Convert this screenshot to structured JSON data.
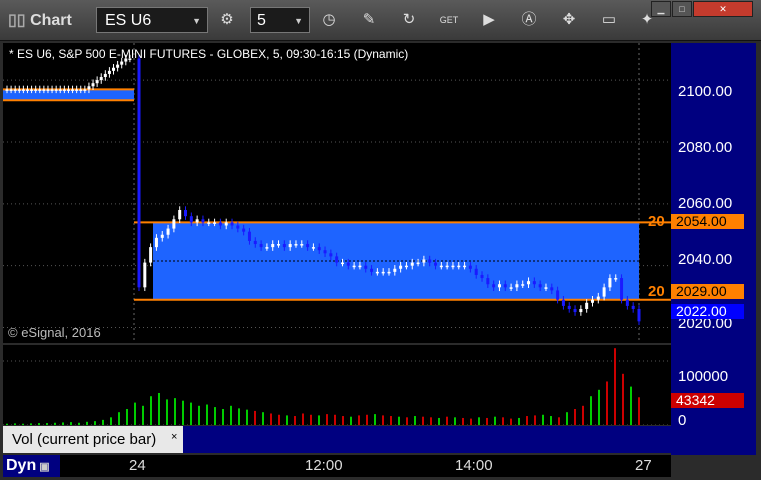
{
  "window": {
    "app_title": "Chart",
    "minimize": "▁",
    "maximize": "□",
    "close": "✕"
  },
  "toolbar": {
    "symbol": "ES U6",
    "interval": "5",
    "icons": [
      "settings-icon",
      "clock-icon",
      "pencil-icon",
      "refresh-icon",
      "get-icon",
      "play-icon",
      "a-icon",
      "tools-icon",
      "comment-icon",
      "twitter-icon"
    ]
  },
  "chart": {
    "title": "* ES U6, S&P 500 E-MINI FUTURES - GLOBEX, 5, 09:30-16:15 (Dynamic)",
    "copyright": "© eSignal, 2016",
    "level_labels": [
      "20",
      "20"
    ]
  },
  "price_axis": {
    "ticks": [
      "2100.00",
      "2080.00",
      "2060.00",
      "2040.00",
      "2020.00"
    ],
    "tags": [
      {
        "value": "2054.00",
        "color": "#ff8000"
      },
      {
        "value": "2029.00",
        "color": "#ff8000"
      },
      {
        "value": "2022.00",
        "color": "#0000ff"
      }
    ]
  },
  "volume_axis": {
    "ticks": [
      "100000",
      "0"
    ],
    "current": "43342",
    "current_color": "#cc0000"
  },
  "volume_study": {
    "label": "Vol (current price bar)",
    "close": "×"
  },
  "time_axis": {
    "mode": "Dyn",
    "labels": [
      "24",
      "12:00",
      "14:00",
      "27"
    ]
  },
  "colors": {
    "box": "#1e64ff",
    "level": "#ff8000",
    "down": "#1a1aff",
    "up": "#ffffff",
    "vol_up": "#00cc00",
    "vol_down": "#cc0000"
  },
  "chart_data": {
    "type": "candlestick",
    "ylim": [
      2015,
      2112
    ],
    "zones": [
      {
        "from": 2093.5,
        "to": 2097
      },
      {
        "from": 2029,
        "to": 2054
      }
    ],
    "price_closes": [
      2097,
      2097,
      2097,
      2097,
      2097,
      2097,
      2097,
      2097,
      2097,
      2097,
      2097,
      2097,
      2097,
      2097,
      2097,
      2097,
      2097,
      2097,
      2097,
      2097,
      2098,
      2099,
      2100,
      2101,
      2102,
      2103,
      2104,
      2105,
      2106,
      2107,
      2107,
      2033,
      2041,
      2046,
      2049,
      2050,
      2052,
      2055,
      2058,
      2056,
      2054,
      2055,
      2054,
      2054,
      2054,
      2053,
      2054,
      2053,
      2052,
      2051,
      2048,
      2047,
      2046,
      2046,
      2047,
      2047,
      2046,
      2047,
      2047,
      2047,
      2046,
      2046,
      2045,
      2044,
      2043,
      2041,
      2041,
      2040,
      2040,
      2040,
      2039,
      2038,
      2038,
      2038,
      2038,
      2039,
      2040,
      2040,
      2041,
      2041,
      2042,
      2041,
      2040,
      2040,
      2040,
      2040,
      2040,
      2040,
      2039,
      2037,
      2036,
      2034,
      2033,
      2034,
      2033,
      2033,
      2034,
      2034,
      2035,
      2034,
      2033,
      2033,
      2032,
      2029,
      2027,
      2026,
      2025,
      2026,
      2028,
      2029,
      2030,
      2033,
      2036,
      2036,
      2029,
      2027,
      2026,
      2022
    ],
    "volume": [
      2000,
      2500,
      2000,
      2500,
      3000,
      3000,
      3500,
      4000,
      4500,
      3500,
      5000,
      6000,
      8000,
      12000,
      20000,
      25000,
      35000,
      30000,
      45000,
      50000,
      40000,
      42000,
      38000,
      35000,
      30000,
      32000,
      28000,
      25000,
      30000,
      26000,
      24000,
      22000,
      20000,
      18000,
      16000,
      15000,
      14000,
      18000,
      16000,
      15000,
      17000,
      16000,
      14000,
      13000,
      15000,
      16000,
      17000,
      15000,
      14000,
      13000,
      12000,
      14000,
      13000,
      12000,
      11000,
      13000,
      12000,
      11000,
      10000,
      12000,
      11000,
      13000,
      12000,
      10000,
      11000,
      14000,
      15000,
      16000,
      14000,
      12000,
      20000,
      25000,
      30000,
      45000,
      55000,
      68000,
      120000,
      80000,
      60000,
      43342
    ],
    "volume_ylim": [
      0,
      125000
    ],
    "volume_up_flags": [
      1,
      1,
      1,
      1,
      1,
      1,
      1,
      1,
      1,
      1,
      1,
      1,
      1,
      1,
      1,
      1,
      1,
      1,
      1,
      1,
      1,
      1,
      1,
      1,
      1,
      1,
      1,
      1,
      1,
      1,
      1,
      0,
      1,
      0,
      0,
      1,
      0,
      0,
      0,
      1,
      0,
      0,
      0,
      1,
      0,
      0,
      1,
      0,
      0,
      1,
      0,
      1,
      0,
      0,
      1,
      0,
      1,
      0,
      0,
      1,
      0,
      1,
      0,
      0,
      1,
      0,
      0,
      1,
      1,
      0,
      1,
      0,
      0,
      1,
      1,
      0,
      0,
      0,
      1,
      0
    ],
    "x_labels": [
      "24",
      "12:00",
      "14:00",
      "27"
    ]
  }
}
